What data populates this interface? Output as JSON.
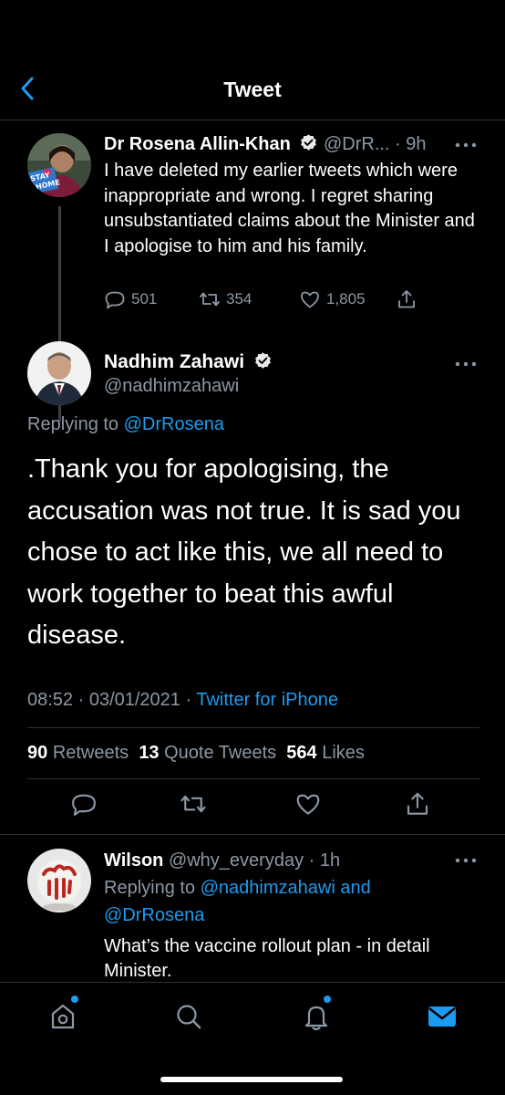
{
  "header": {
    "title": "Tweet"
  },
  "parent_tweet": {
    "author_name": "Dr Rosena Allin-Khan",
    "handle_time": "@DrR... · 9h",
    "avatar_badge_line1": "STAY",
    "avatar_badge_line2": "HOME",
    "text": "I have deleted my earlier tweets which were inappropriate and wrong. I regret sharing unsubstantiated claims about the Minister and I apologise to him and his family.",
    "replies": "501",
    "retweets": "354",
    "likes": "1,805"
  },
  "main_tweet": {
    "author_name": "Nadhim Zahawi",
    "handle": "@nadhimzahawi",
    "replying_prefix": "Replying to ",
    "replying_handle": "@DrRosena",
    "text": ".Thank you for apologising, the accusation was not true. It is sad you chose to act like this, we all need to work together to beat this awful disease.",
    "timestamp": "08:52 · 03/01/2021 · ",
    "source": "Twitter for iPhone",
    "retweets_count": "90",
    "retweets_label": "Retweets",
    "quotes_count": "13",
    "quotes_label": "Quote Tweets",
    "likes_count": "564",
    "likes_label": "Likes"
  },
  "reply_tweet": {
    "author_name": "Wilson",
    "handle_time": "@why_everyday · 1h",
    "replying_prefix": "Replying to ",
    "replying_handles": "@nadhimzahawi and @DrRosena",
    "text": "What’s the vaccine rollout plan - in detail Minister."
  },
  "tabbar": {
    "items": [
      "home-icon",
      "search-icon",
      "notifications-icon",
      "messages-icon"
    ],
    "active": "messages-icon"
  },
  "colors": {
    "accent": "#1d9bf0",
    "background": "#000000",
    "muted": "#8b98a5",
    "divider": "#2f3336"
  }
}
